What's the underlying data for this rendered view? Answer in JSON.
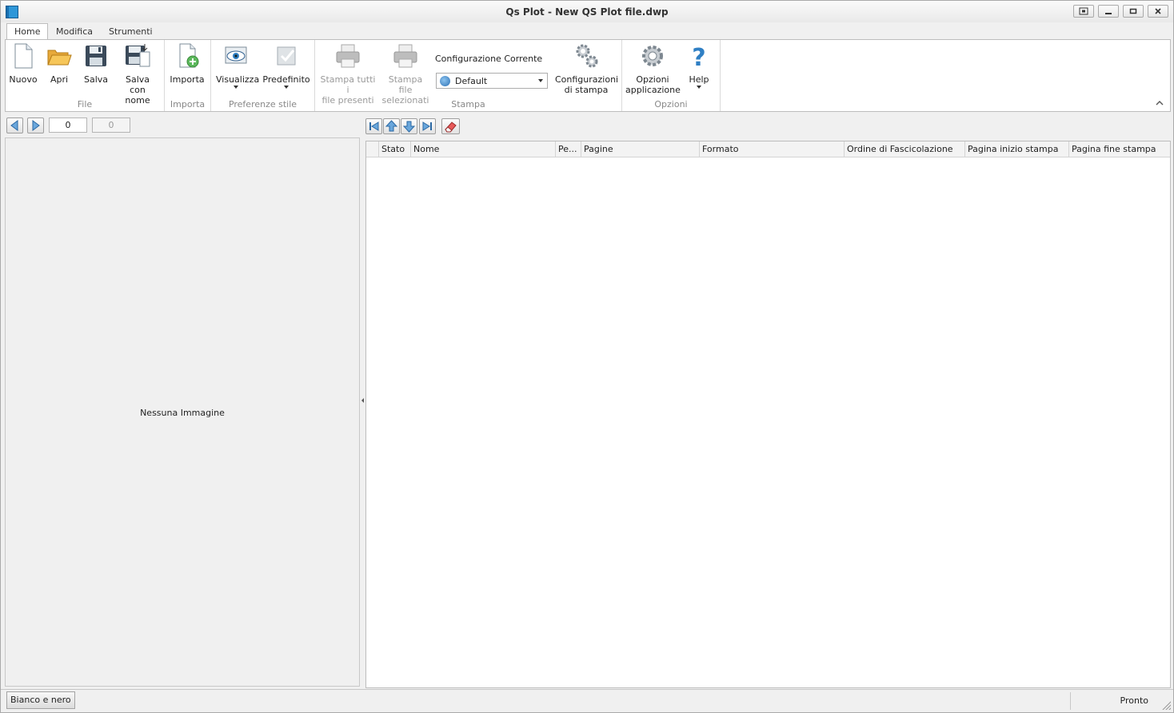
{
  "window": {
    "title": "Qs Plot - New QS Plot file.dwp"
  },
  "tabs": [
    {
      "label": "Home",
      "active": true
    },
    {
      "label": "Modifica",
      "active": false
    },
    {
      "label": "Strumenti",
      "active": false
    }
  ],
  "ribbon": {
    "file": {
      "label": "File",
      "nuovo": "Nuovo",
      "apri": "Apri",
      "salva": "Salva",
      "salva_con_nome_1": "Salva",
      "salva_con_nome_2": "con nome"
    },
    "importa": {
      "label": "Importa",
      "button": "Importa"
    },
    "preferenze": {
      "label": "Preferenze stile",
      "visualizza": "Visualizza",
      "predefinito": "Predefinito"
    },
    "stampa": {
      "label": "Stampa",
      "stampa_tutti_1": "Stampa tutti i",
      "stampa_tutti_2": "file presenti",
      "stampa_sel_1": "Stampa file",
      "stampa_sel_2": "selezionati",
      "config_label": "Configurazione Corrente",
      "config_value": "Default",
      "config_btn_1": "Configurazioni",
      "config_btn_2": "di stampa"
    },
    "opzioni": {
      "label": "Opzioni",
      "opzioni_1": "Opzioni",
      "opzioni_2": "applicazione",
      "help": "Help"
    }
  },
  "preview": {
    "page_current": "0",
    "page_total": "0",
    "empty_message": "Nessuna Immagine"
  },
  "grid": {
    "columns": [
      "",
      "Stato",
      "Nome",
      "Pe...",
      "Pagine",
      "Formato",
      "Ordine di Fascicolazione",
      "Pagina inizio stampa",
      "Pagina fine stampa"
    ],
    "rows": []
  },
  "status": {
    "bw_button": "Bianco e nero",
    "state": "Pronto"
  },
  "colors": {
    "accent_blue": "#2f7fc4",
    "ribbon_bg": "#ffffff",
    "window_bg": "#f0f0f0"
  }
}
